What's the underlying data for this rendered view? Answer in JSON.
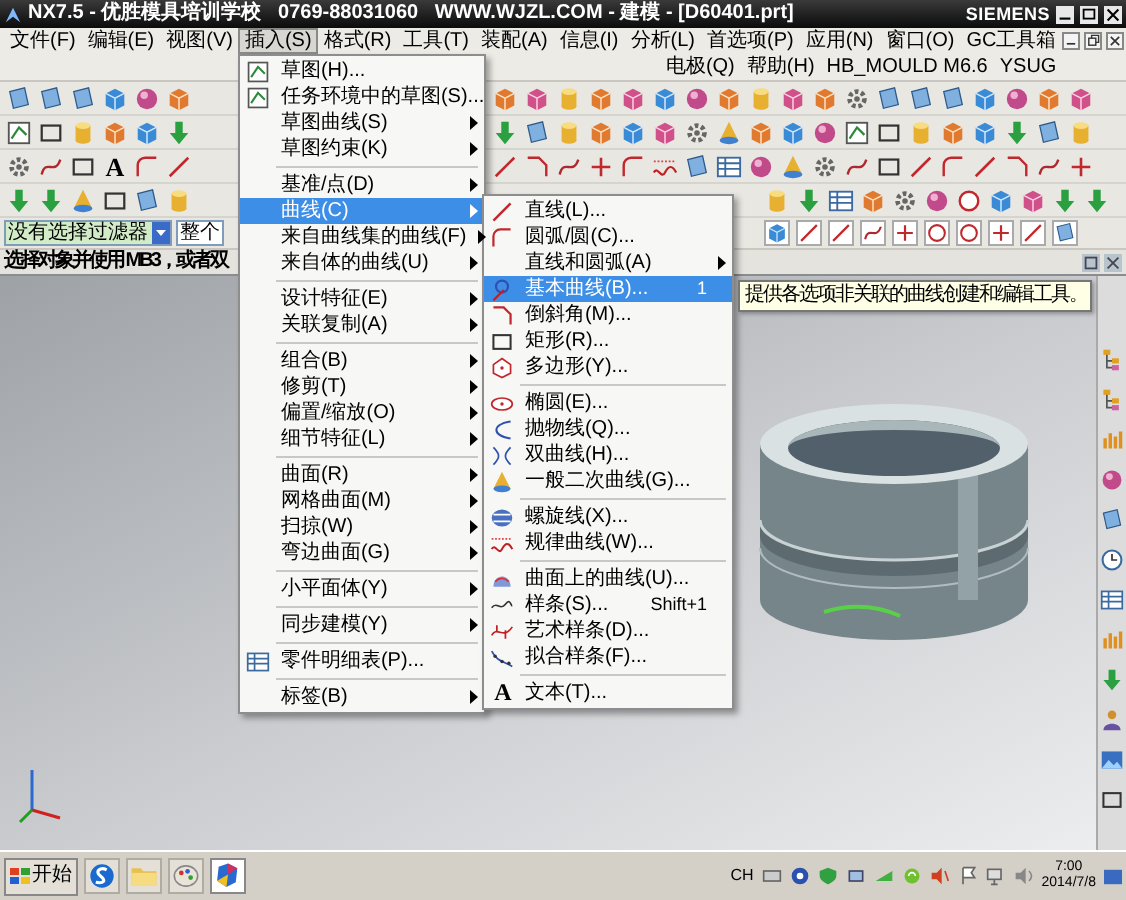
{
  "window": {
    "title": "NX7.5 - 优胜模具培训学校   0769-88031060   WWW.WJZL.COM - 建模 - [D60401.prt]",
    "brand": "SIEMENS"
  },
  "menu_bar": [
    {
      "label": "文件(F)",
      "selected": false
    },
    {
      "label": "编辑(E)",
      "selected": false
    },
    {
      "label": "视图(V)",
      "selected": false
    },
    {
      "label": "插入(S)",
      "selected": true
    },
    {
      "label": "格式(R)",
      "selected": false
    },
    {
      "label": "工具(T)",
      "selected": false
    },
    {
      "label": "装配(A)",
      "selected": false
    },
    {
      "label": "信息(I)",
      "selected": false
    },
    {
      "label": "分析(L)",
      "selected": false
    },
    {
      "label": "首选项(P)",
      "selected": false
    },
    {
      "label": "应用(N)",
      "selected": false
    },
    {
      "label": "窗口(O)",
      "selected": false
    },
    {
      "label": "GC工具箱",
      "selected": false
    },
    {
      "label": "电极(Q)",
      "selected": false
    },
    {
      "label": "帮助(H)",
      "selected": false
    },
    {
      "label": "HB_MOULD M6.6",
      "selected": false
    },
    {
      "label": "YSUG",
      "selected": false
    }
  ],
  "toolbar": {
    "text_tool_glyph": "A"
  },
  "selection_bar": {
    "filter": "没有选择过滤器",
    "scope": "整个"
  },
  "prompt": "选择对象并使用 MB3，或者双",
  "insert_menu": [
    {
      "kind": "item",
      "label": "草图(H)...",
      "submenu": false,
      "selected": false
    },
    {
      "kind": "item",
      "label": "任务环境中的草图(S)...",
      "submenu": false,
      "selected": false
    },
    {
      "kind": "item",
      "label": "草图曲线(S)",
      "submenu": true,
      "selected": false
    },
    {
      "kind": "item",
      "label": "草图约束(K)",
      "submenu": true,
      "selected": false
    },
    {
      "kind": "separator"
    },
    {
      "kind": "item",
      "label": "基准/点(D)",
      "submenu": true,
      "selected": false
    },
    {
      "kind": "item",
      "label": "曲线(C)",
      "submenu": true,
      "selected": true
    },
    {
      "kind": "item",
      "label": "来自曲线集的曲线(F)",
      "submenu": true,
      "selected": false
    },
    {
      "kind": "item",
      "label": "来自体的曲线(U)",
      "submenu": true,
      "selected": false
    },
    {
      "kind": "separator"
    },
    {
      "kind": "item",
      "label": "设计特征(E)",
      "submenu": true,
      "selected": false
    },
    {
      "kind": "item",
      "label": "关联复制(A)",
      "submenu": true,
      "selected": false
    },
    {
      "kind": "separator"
    },
    {
      "kind": "item",
      "label": "组合(B)",
      "submenu": true,
      "selected": false
    },
    {
      "kind": "item",
      "label": "修剪(T)",
      "submenu": true,
      "selected": false
    },
    {
      "kind": "item",
      "label": "偏置/缩放(O)",
      "submenu": true,
      "selected": false
    },
    {
      "kind": "item",
      "label": "细节特征(L)",
      "submenu": true,
      "selected": false
    },
    {
      "kind": "separator"
    },
    {
      "kind": "item",
      "label": "曲面(R)",
      "submenu": true,
      "selected": false
    },
    {
      "kind": "item",
      "label": "网格曲面(M)",
      "submenu": true,
      "selected": false
    },
    {
      "kind": "item",
      "label": "扫掠(W)",
      "submenu": true,
      "selected": false
    },
    {
      "kind": "item",
      "label": "弯边曲面(G)",
      "submenu": true,
      "selected": false
    },
    {
      "kind": "separator"
    },
    {
      "kind": "item",
      "label": "小平面体(Y)",
      "submenu": true,
      "selected": false
    },
    {
      "kind": "separator"
    },
    {
      "kind": "item",
      "label": "同步建模(Y)",
      "submenu": true,
      "selected": false
    },
    {
      "kind": "separator"
    },
    {
      "kind": "item",
      "label": "零件明细表(P)...",
      "submenu": false,
      "selected": false
    },
    {
      "kind": "separator"
    },
    {
      "kind": "item",
      "label": "标签(B)",
      "submenu": true,
      "selected": false
    }
  ],
  "curve_submenu": [
    {
      "kind": "item",
      "label": "直线(L)...",
      "submenu": false,
      "selected": false
    },
    {
      "kind": "item",
      "label": "圆弧/圆(C)...",
      "submenu": false,
      "selected": false
    },
    {
      "kind": "item",
      "label": "直线和圆弧(A)",
      "submenu": true,
      "selected": false
    },
    {
      "kind": "item",
      "label": "基本曲线(B)...",
      "shortcut": "1",
      "submenu": false,
      "selected": true
    },
    {
      "kind": "item",
      "label": "倒斜角(M)...",
      "submenu": false,
      "selected": false
    },
    {
      "kind": "item",
      "label": "矩形(R)...",
      "submenu": false,
      "selected": false
    },
    {
      "kind": "item",
      "label": "多边形(Y)...",
      "submenu": false,
      "selected": false
    },
    {
      "kind": "separator"
    },
    {
      "kind": "item",
      "label": "椭圆(E)...",
      "submenu": false,
      "selected": false
    },
    {
      "kind": "item",
      "label": "抛物线(Q)...",
      "submenu": false,
      "selected": false
    },
    {
      "kind": "item",
      "label": "双曲线(H)...",
      "submenu": false,
      "selected": false
    },
    {
      "kind": "item",
      "label": "一般二次曲线(G)...",
      "submenu": false,
      "selected": false
    },
    {
      "kind": "separator"
    },
    {
      "kind": "item",
      "label": "螺旋线(X)...",
      "submenu": false,
      "selected": false
    },
    {
      "kind": "item",
      "label": "规律曲线(W)...",
      "submenu": false,
      "selected": false
    },
    {
      "kind": "separator"
    },
    {
      "kind": "item",
      "label": "曲面上的曲线(U)...",
      "submenu": false,
      "selected": false
    },
    {
      "kind": "item",
      "label": "样条(S)...",
      "shortcut": "Shift+1",
      "submenu": false,
      "selected": false
    },
    {
      "kind": "item",
      "label": "艺术样条(D)...",
      "submenu": false,
      "selected": false
    },
    {
      "kind": "item",
      "label": "拟合样条(F)...",
      "submenu": false,
      "selected": false
    },
    {
      "kind": "separator"
    },
    {
      "kind": "item",
      "label": "文本(T)...",
      "icon_text": "A",
      "submenu": false,
      "selected": false
    }
  ],
  "tooltip": "提供各选项非关联的曲线创建和编辑工具。",
  "taskbar": {
    "start": "开始",
    "language": "CH",
    "time": "7:00",
    "date": "2014/7/8"
  }
}
